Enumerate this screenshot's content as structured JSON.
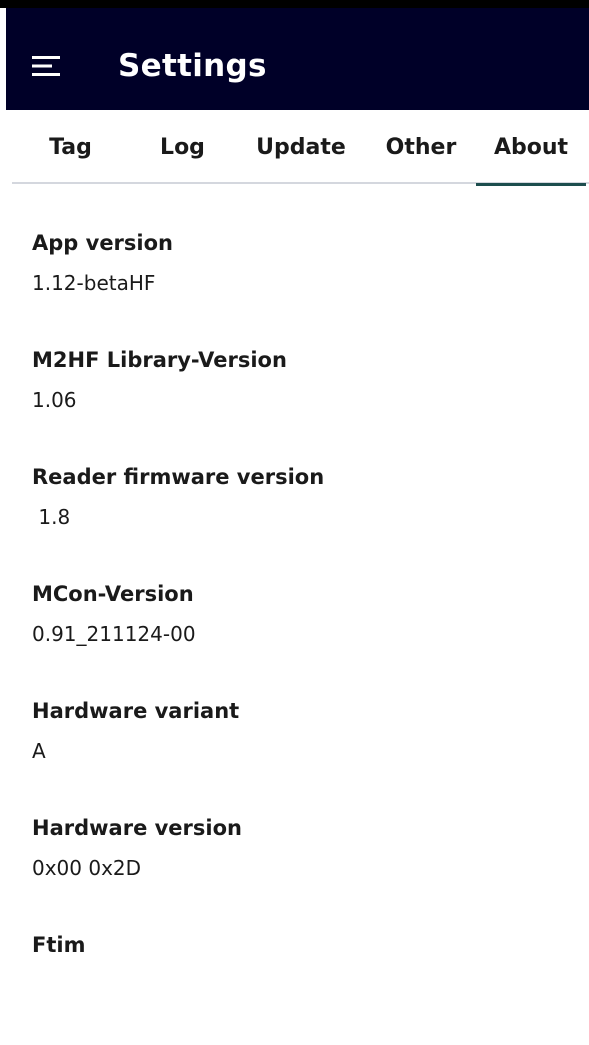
{
  "header": {
    "title": "Settings",
    "menu_icon": "hamburger-menu-icon"
  },
  "tabs": [
    {
      "label": "Tag",
      "active": false
    },
    {
      "label": "Log",
      "active": false
    },
    {
      "label": "Update",
      "active": false
    },
    {
      "label": "Other",
      "active": false
    },
    {
      "label": "About",
      "active": true
    }
  ],
  "about": {
    "items": [
      {
        "label": "App version",
        "value": "1.12-betaHF"
      },
      {
        "label": "M2HF Library-Version",
        "value": "1.06"
      },
      {
        "label": "Reader firmware version",
        "value": " 1.8"
      },
      {
        "label": "MCon-Version",
        "value": "0.91_211124-00"
      },
      {
        "label": "Hardware variant",
        "value": "A"
      },
      {
        "label": "Hardware version",
        "value": "0x00 0x2D"
      },
      {
        "label": "Ftim",
        "value": ""
      }
    ]
  },
  "colors": {
    "appbar": "#000028",
    "tab_indicator": "#1d4e4e",
    "divider": "#d4d7de"
  }
}
